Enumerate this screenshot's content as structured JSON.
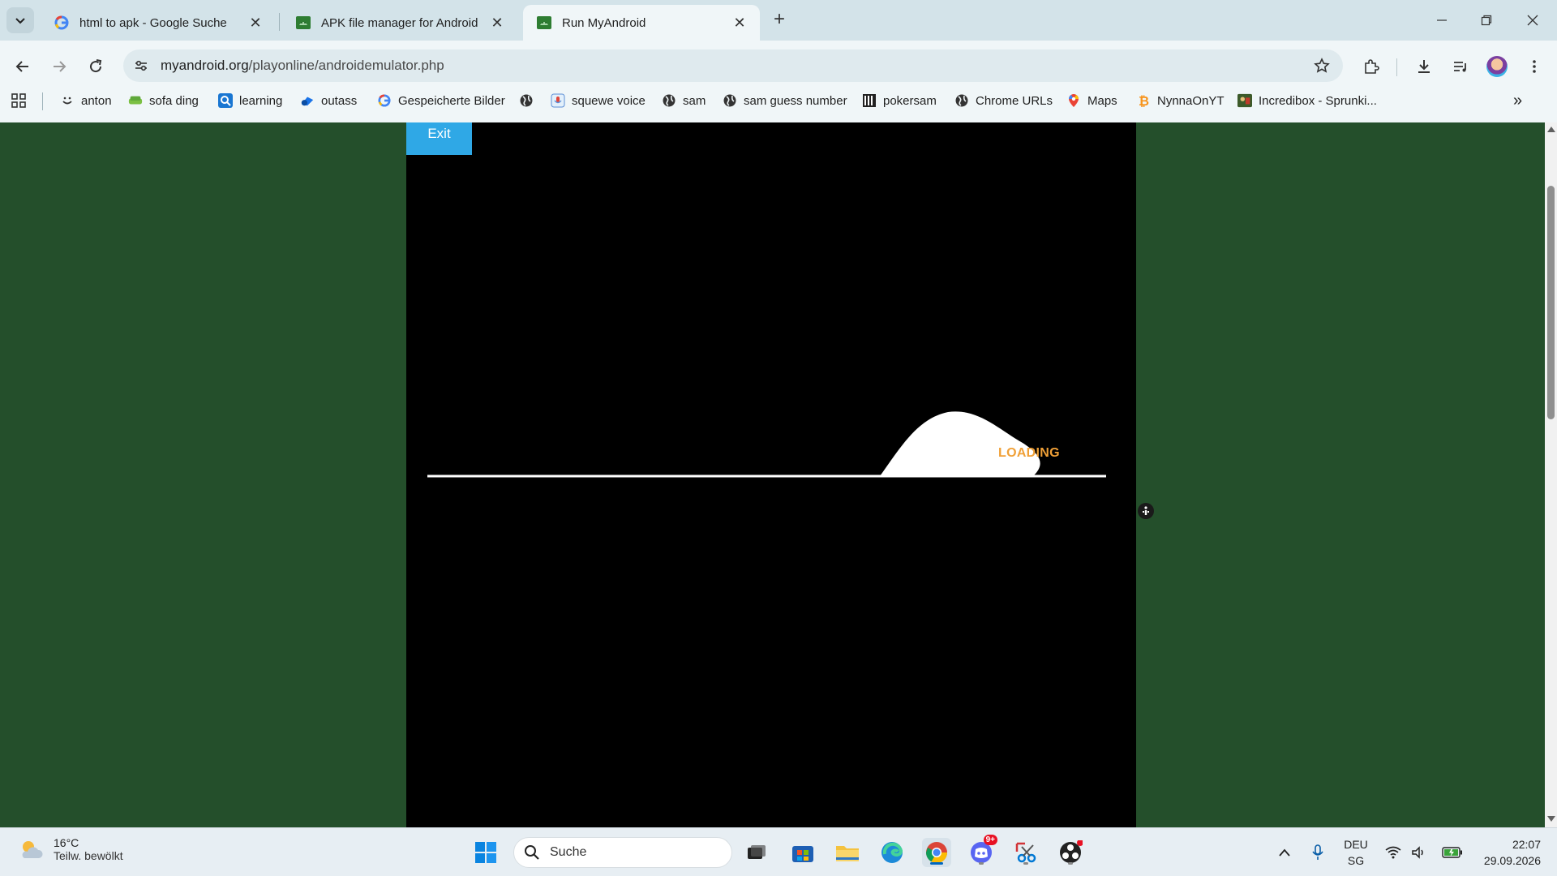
{
  "tabs": [
    {
      "title": "html to apk - Google Suche",
      "icon": "google-icon"
    },
    {
      "title": "APK file manager for Android e",
      "icon": "android-app-icon"
    },
    {
      "title": "Run MyAndroid",
      "icon": "android-app-icon",
      "active": true
    }
  ],
  "address_bar": {
    "host": "myandroid.org",
    "path": "/playonline/androidemulator.php"
  },
  "bookmarks": [
    {
      "label": "anton",
      "icon": "smile-icon"
    },
    {
      "label": "sofa ding",
      "icon": "sofa-icon"
    },
    {
      "label": "learning",
      "icon": "learning-icon"
    },
    {
      "label": "outass",
      "icon": "outlook-icon"
    },
    {
      "label": "Gespeicherte Bilder",
      "icon": "google-icon"
    },
    {
      "label": "",
      "icon": "globe-icon"
    },
    {
      "label": "squewe voice",
      "icon": "voice-icon"
    },
    {
      "label": "sam",
      "icon": "globe-icon"
    },
    {
      "label": "sam guess number",
      "icon": "globe-icon"
    },
    {
      "label": "pokersam",
      "icon": "poker-icon"
    },
    {
      "label": "Chrome URLs",
      "icon": "globe-icon"
    },
    {
      "label": "Maps",
      "icon": "maps-icon"
    },
    {
      "label": "NynnaOnYT",
      "icon": "bitcoin-icon"
    },
    {
      "label": "Incredibox - Sprunki...",
      "icon": "incredibox-icon"
    }
  ],
  "emulator": {
    "exit_label": "Exit",
    "loading_text": "LOADING"
  },
  "taskbar": {
    "weather_temp": "16°C",
    "weather_desc": "Teilw. bewölkt",
    "search_placeholder": "Suche",
    "lang_line1": "DEU",
    "lang_line2": "SG",
    "time": "22:07",
    "date": "29.09.2026",
    "notification_badge": "9+"
  },
  "colors": {
    "page_bg": "#244f2b",
    "exit_button": "#2fa8e6",
    "loading_text": "#f0a037",
    "tabstrip_bg": "#d3e3e9"
  }
}
